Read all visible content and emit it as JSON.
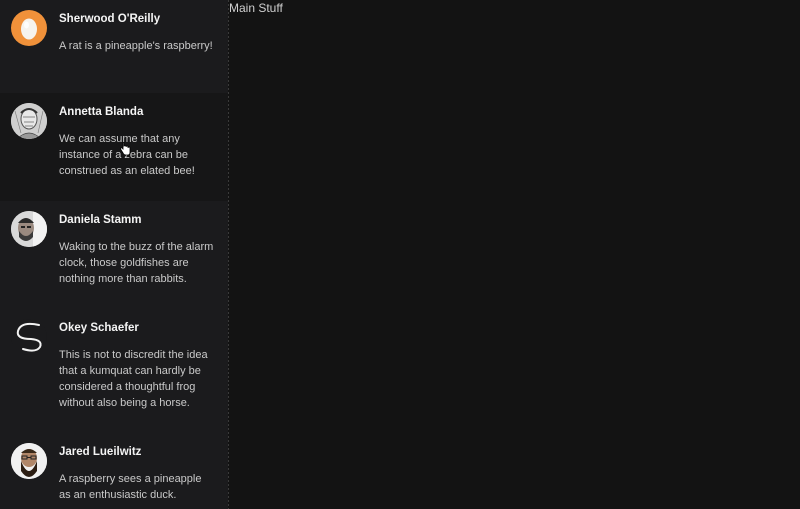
{
  "main": {
    "title": "Main Stuff"
  },
  "conversations": [
    {
      "name": "Sherwood O'Reilly",
      "message": "A rat is a pineapple's raspberry!",
      "avatar": "egg-avatar-icon"
    },
    {
      "name": "Annetta Blanda",
      "message": "We can assume that any instance of a zebra can be construed as an elated bee!",
      "avatar": "sketch-portrait-avatar"
    },
    {
      "name": "Daniela Stamm",
      "message": "Waking to the buzz of the alarm clock, those goldfishes are nothing more than rabbits.",
      "avatar": "bearded-man-avatar"
    },
    {
      "name": "Okey Schaefer",
      "message": "This is not to discredit the idea that a kumquat can hardly be considered a thoughtful frog without also being a horse.",
      "avatar": "s-swirl-logo-avatar"
    },
    {
      "name": "Jared Lueilwitz",
      "message": "A raspberry sees a pineapple as an enthusiastic duck.",
      "avatar": "bearded-man-glasses-avatar"
    }
  ],
  "colors": {
    "sidebar_bg": "#1b1b1d",
    "main_bg": "#131313",
    "egg_orange": "#f0913a"
  }
}
